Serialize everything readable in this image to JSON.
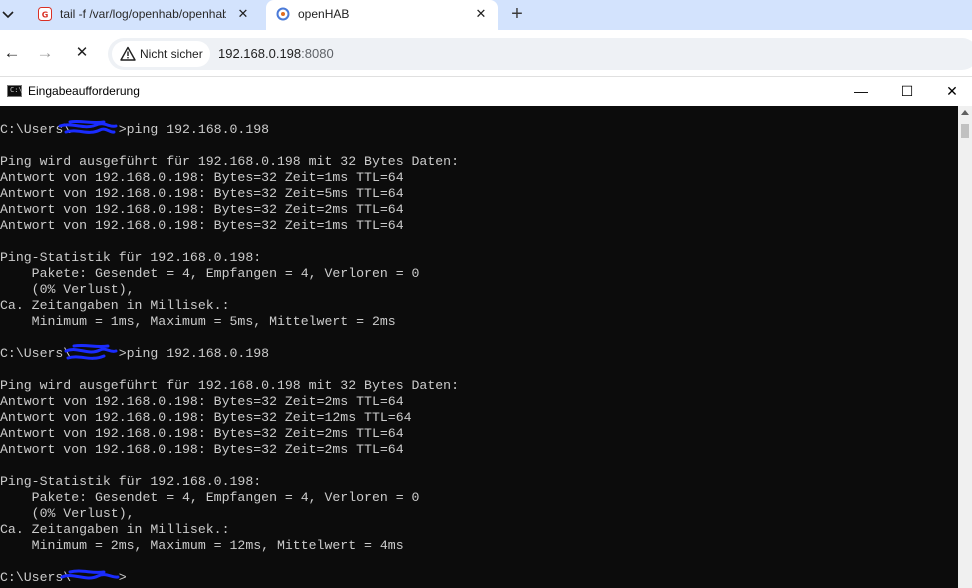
{
  "browser": {
    "tabs": [
      {
        "title": "tail -f /var/log/openhab/openhab",
        "favicon": "shell-favicon",
        "active": false
      },
      {
        "title": "openHAB",
        "favicon": "openhab-favicon",
        "active": true
      }
    ],
    "close_glyph": "✕",
    "new_tab_glyph": "+",
    "tab_menu_glyph": "⌄",
    "nav": {
      "back": "←",
      "forward": "→",
      "stop": "✕"
    },
    "security_label": "Nicht sicher",
    "url_host": "192.168.0.198",
    "url_port": ":8080"
  },
  "console_window": {
    "title": "Eingabeaufforderung",
    "icon_text": "C:\\",
    "minimize": "—",
    "maximize": "☐",
    "close": "✕"
  },
  "console_lines": [
    "C:\\Users\\      >ping 192.168.0.198",
    "",
    "Ping wird ausgeführt für 192.168.0.198 mit 32 Bytes Daten:",
    "Antwort von 192.168.0.198: Bytes=32 Zeit=1ms TTL=64",
    "Antwort von 192.168.0.198: Bytes=32 Zeit=5ms TTL=64",
    "Antwort von 192.168.0.198: Bytes=32 Zeit=2ms TTL=64",
    "Antwort von 192.168.0.198: Bytes=32 Zeit=1ms TTL=64",
    "",
    "Ping-Statistik für 192.168.0.198:",
    "    Pakete: Gesendet = 4, Empfangen = 4, Verloren = 0",
    "    (0% Verlust),",
    "Ca. Zeitangaben in Millisek.:",
    "    Minimum = 1ms, Maximum = 5ms, Mittelwert = 2ms",
    "",
    "C:\\Users\\      >ping 192.168.0.198",
    "",
    "Ping wird ausgeführt für 192.168.0.198 mit 32 Bytes Daten:",
    "Antwort von 192.168.0.198: Bytes=32 Zeit=2ms TTL=64",
    "Antwort von 192.168.0.198: Bytes=32 Zeit=12ms TTL=64",
    "Antwort von 192.168.0.198: Bytes=32 Zeit=2ms TTL=64",
    "Antwort von 192.168.0.198: Bytes=32 Zeit=2ms TTL=64",
    "",
    "Ping-Statistik für 192.168.0.198:",
    "    Pakete: Gesendet = 4, Empfangen = 4, Verloren = 0",
    "    (0% Verlust),",
    "Ca. Zeitangaben in Millisek.:",
    "    Minimum = 2ms, Maximum = 12ms, Mittelwert = 4ms",
    "",
    "C:\\Users\\      >"
  ],
  "colors": {
    "tabbar_bg": "#d3e3fd",
    "console_bg": "#0c0c0c",
    "console_text": "#cccccc",
    "redaction": "#1a2cff",
    "warning_icon": "#1f1f1f"
  }
}
